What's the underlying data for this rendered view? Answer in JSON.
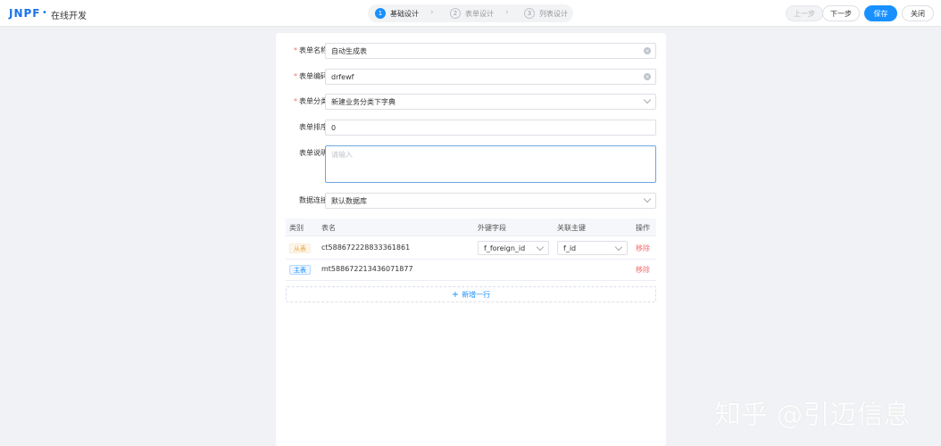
{
  "header": {
    "logo": "JNPF",
    "logo_dot": "•",
    "title": "在线开发",
    "steps": [
      {
        "num": "1",
        "label": "基础设计"
      },
      {
        "num": "2",
        "label": "表单设计"
      },
      {
        "num": "3",
        "label": "列表设计"
      }
    ],
    "buttons": {
      "prev": "上一步",
      "next": "下一步",
      "save": "保存",
      "close": "关闭"
    }
  },
  "form": {
    "name": {
      "label": "表单名称",
      "value": "自动生成表"
    },
    "code": {
      "label": "表单编码",
      "value": "drfewf"
    },
    "category": {
      "label": "表单分类",
      "value": "新建业务分类下字典"
    },
    "sort": {
      "label": "表单排序",
      "value": "0"
    },
    "desc": {
      "label": "表单说明",
      "placeholder": "请输入"
    },
    "db": {
      "label": "数据连接",
      "value": "默认数据库"
    }
  },
  "table": {
    "headers": {
      "type": "类别",
      "name": "表名",
      "fk": "外键字段",
      "pk": "关联主键",
      "op": "操作"
    },
    "rows": [
      {
        "type": "从表",
        "name": "ct588672228833361861",
        "fk": "f_foreign_id",
        "pk": "f_id",
        "op": "移除"
      },
      {
        "type": "主表",
        "name": "mt588672213436071877",
        "op": "移除"
      }
    ],
    "add_label": "新增一行"
  },
  "watermark": "知乎 @引迈信息"
}
